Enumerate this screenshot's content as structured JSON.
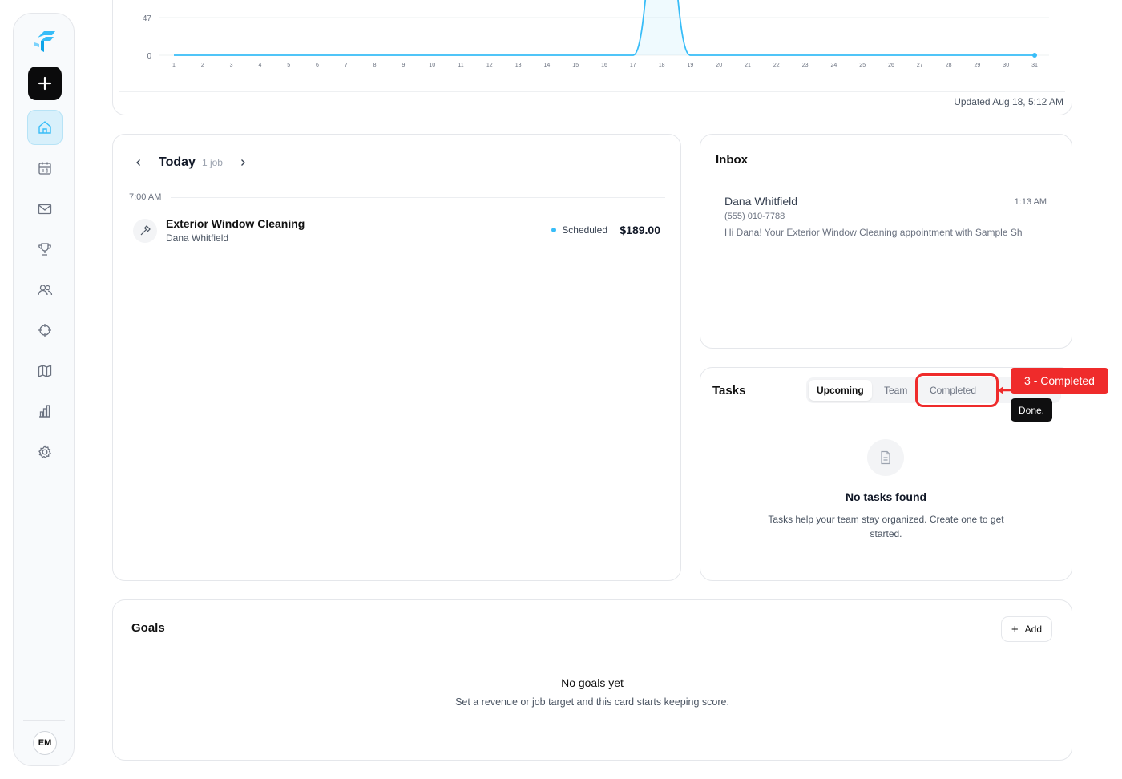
{
  "sidebar": {
    "logo_icon": "brand-logo",
    "new_button_icon": "plus-icon",
    "items": [
      {
        "name": "home",
        "icon": "home-icon",
        "active": true
      },
      {
        "name": "calendar",
        "icon": "calendar-icon",
        "active": false
      },
      {
        "name": "messages",
        "icon": "mail-icon",
        "active": false
      },
      {
        "name": "goals",
        "icon": "trophy-icon",
        "active": false
      },
      {
        "name": "clients",
        "icon": "users-icon",
        "active": false
      },
      {
        "name": "dispatch",
        "icon": "crosshair-icon",
        "active": false
      },
      {
        "name": "map",
        "icon": "map-icon",
        "active": false
      },
      {
        "name": "reports",
        "icon": "bar-chart-icon",
        "active": false
      },
      {
        "name": "settings",
        "icon": "gear-icon",
        "active": false
      }
    ],
    "avatar_initials": "EM"
  },
  "chart_data": {
    "type": "line",
    "x": [
      1,
      2,
      3,
      4,
      5,
      6,
      7,
      8,
      9,
      10,
      11,
      12,
      13,
      14,
      15,
      16,
      17,
      18,
      19,
      20,
      21,
      22,
      23,
      24,
      25,
      26,
      27,
      28,
      29,
      30,
      31
    ],
    "x_ticks": [
      "1",
      "2",
      "3",
      "4",
      "5",
      "6",
      "7",
      "8",
      "9",
      "10",
      "11",
      "12",
      "13",
      "14",
      "15",
      "16",
      "17",
      "18",
      "19",
      "20",
      "21",
      "22",
      "23",
      "24",
      "25",
      "26",
      "27",
      "28",
      "29",
      "30",
      "31"
    ],
    "y_ticks": [
      "0",
      "47"
    ],
    "y_values": [
      0,
      0,
      0,
      0,
      0,
      0,
      0,
      0,
      0,
      0,
      0,
      0,
      0,
      0,
      0,
      0,
      0,
      189,
      0,
      0,
      0,
      0,
      0,
      0,
      0,
      0,
      0,
      0,
      0,
      0,
      0
    ],
    "ylim": [
      0,
      189
    ],
    "grid": true,
    "line_color": "#38bdf8",
    "updated_label": "Updated Aug 18, 5:12 AM"
  },
  "schedule": {
    "day_label": "Today",
    "job_count": "1 job",
    "time_label": "7:00 AM",
    "job": {
      "icon": "hammer-icon",
      "title": "Exterior Window Cleaning",
      "client": "Dana Whitfield",
      "status": "Scheduled",
      "status_color": "#38bdf8",
      "price": "$189.00"
    }
  },
  "inbox": {
    "title": "Inbox",
    "message": {
      "sender": "Dana Whitfield",
      "time": "1:13 AM",
      "phone": "(555) 010-7788",
      "preview": "Hi Dana! Your Exterior Window Cleaning appointment with Sample Sh"
    }
  },
  "tasks": {
    "title": "Tasks",
    "tabs": [
      "Upcoming",
      "Team",
      "Completed"
    ],
    "empty_title": "No tasks found",
    "empty_desc": "Tasks help your team stay organized. Create one to get started."
  },
  "annotation": {
    "label": "3 - Completed",
    "tooltip": "Done.",
    "color": "#ef2b2b"
  },
  "goals": {
    "title": "Goals",
    "add_label": "Add",
    "empty_title": "No goals yet",
    "empty_desc": "Set a revenue or job target and this card starts keeping score."
  }
}
